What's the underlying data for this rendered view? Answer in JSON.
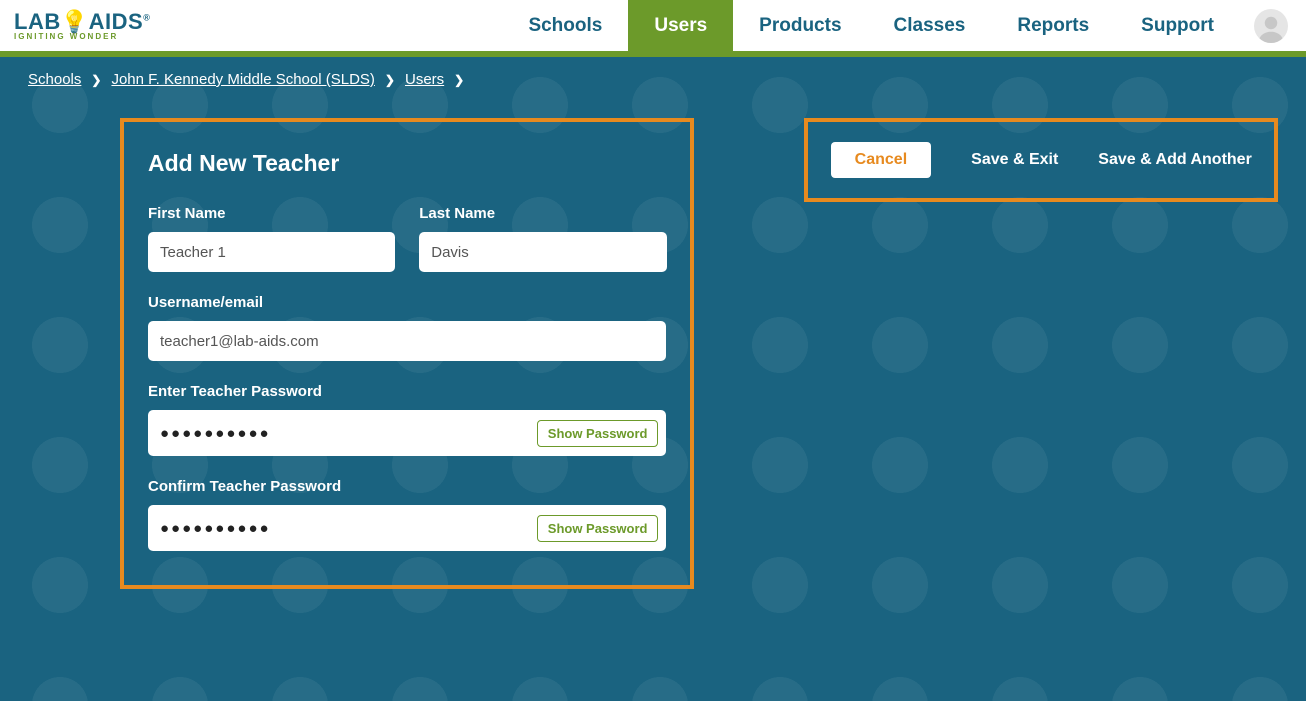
{
  "logo": {
    "top_a": "LAB",
    "top_b": "AIDS",
    "tagline": "IGNITING WONDER"
  },
  "nav": {
    "schools": "Schools",
    "users": "Users",
    "products": "Products",
    "classes": "Classes",
    "reports": "Reports",
    "support": "Support"
  },
  "breadcrumb": {
    "schools": "Schools",
    "school_name": "John F. Kennedy Middle School (SLDS)",
    "users": "Users"
  },
  "form": {
    "title": "Add New Teacher",
    "first_name_label": "First Name",
    "first_name_value": "Teacher 1",
    "last_name_label": "Last Name",
    "last_name_value": "Davis",
    "username_label": "Username/email",
    "username_value": "teacher1@lab-aids.com",
    "password_label": "Enter Teacher Password",
    "password_value": "●●●●●●●●●●",
    "confirm_label": "Confirm Teacher Password",
    "confirm_value": "●●●●●●●●●●",
    "show_password": "Show Password"
  },
  "actions": {
    "cancel": "Cancel",
    "save_exit": "Save & Exit",
    "save_add": "Save & Add Another"
  }
}
